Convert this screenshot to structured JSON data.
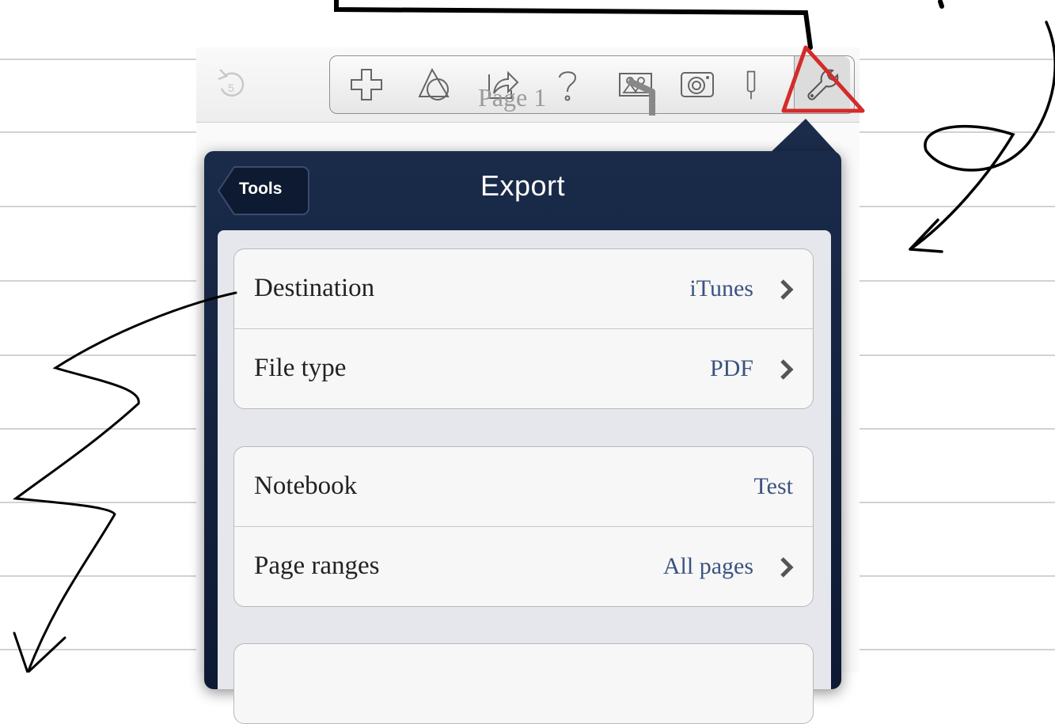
{
  "toolbar": {
    "undo_icon": "undo-icon",
    "tools": [
      "plus-icon",
      "shapes-icon",
      "share-icon",
      "help-icon",
      "people-icon",
      "camera-icon",
      "microphone-icon",
      "wrench-icon"
    ]
  },
  "page": {
    "label": "Page 1"
  },
  "popover": {
    "title": "Export",
    "back_label": "Tools",
    "groups": [
      {
        "rows": [
          {
            "label": "Destination",
            "value": "iTunes",
            "chevron": true
          },
          {
            "label": "File type",
            "value": "PDF",
            "chevron": true
          }
        ]
      },
      {
        "rows": [
          {
            "label": "Notebook",
            "value": "Test",
            "chevron": false
          },
          {
            "label": "Page ranges",
            "value": "All pages",
            "chevron": true
          }
        ]
      }
    ]
  },
  "colors": {
    "nav_bar": "#142341",
    "value_text": "#3a5380",
    "annotation_red": "#d52a2a",
    "annotation_black": "#000000"
  }
}
